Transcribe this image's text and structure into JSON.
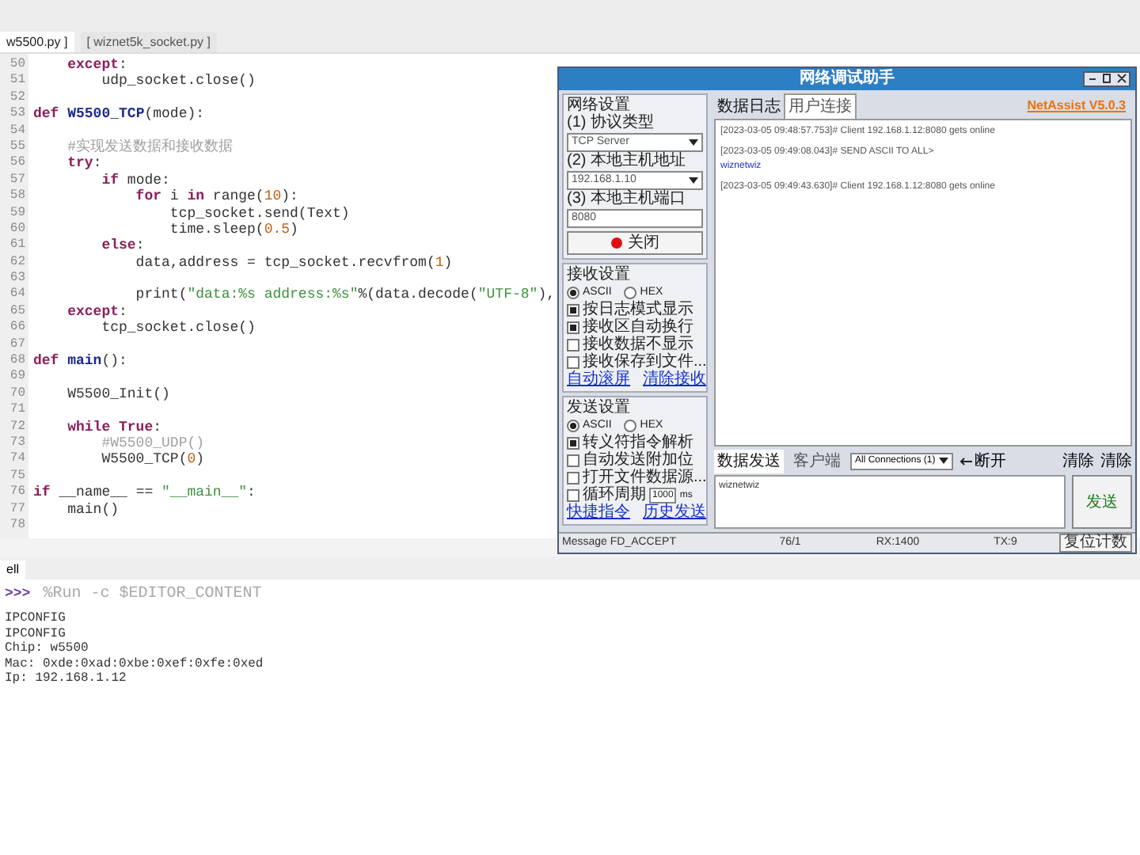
{
  "editor": {
    "tabs": [
      {
        "label": "w5500.py ]",
        "selected": true
      },
      {
        "label": "[ wiznet5k_socket.py ]",
        "selected": false
      }
    ],
    "lines": [
      {
        "number": "50",
        "segments": [
          {
            "kind": "keyword",
            "text": "    except"
          },
          {
            "kind": "plain",
            "text": ":"
          }
        ]
      },
      {
        "number": "51",
        "segments": [
          {
            "kind": "plain",
            "text": "        udp_socket.close()"
          }
        ]
      },
      {
        "number": "52"
      },
      {
        "number": "53",
        "segments": [
          {
            "kind": "keyword",
            "text": "def "
          },
          {
            "kind": "func",
            "text": "W5500_TCP"
          },
          {
            "kind": "plain",
            "text": "(mode):"
          }
        ]
      },
      {
        "number": "54"
      },
      {
        "number": "55",
        "segments": [
          {
            "kind": "comment",
            "text": "    #实现发送数据和接收数据"
          }
        ]
      },
      {
        "number": "56",
        "segments": [
          {
            "kind": "keyword",
            "text": "    try"
          },
          {
            "kind": "plain",
            "text": ":"
          }
        ]
      },
      {
        "number": "57",
        "segments": [
          {
            "kind": "keyword",
            "text": "        if"
          },
          {
            "kind": "plain",
            "text": " mode:"
          }
        ]
      },
      {
        "number": "58",
        "segments": [
          {
            "kind": "keyword",
            "text": "            for"
          },
          {
            "kind": "plain",
            "text": " i "
          },
          {
            "kind": "keyword",
            "text": "in"
          },
          {
            "kind": "plain",
            "text": " range("
          },
          {
            "kind": "number",
            "text": "10"
          },
          {
            "kind": "plain",
            "text": "):"
          }
        ]
      },
      {
        "number": "59",
        "segments": [
          {
            "kind": "plain",
            "text": "                tcp_socket.send(Text)"
          }
        ]
      },
      {
        "number": "60",
        "segments": [
          {
            "kind": "plain",
            "text": "                time.sleep("
          },
          {
            "kind": "number",
            "text": "0.5"
          },
          {
            "kind": "plain",
            "text": ")"
          }
        ]
      },
      {
        "number": "61",
        "segments": [
          {
            "kind": "keyword",
            "text": "        else"
          },
          {
            "kind": "plain",
            "text": ":"
          }
        ]
      },
      {
        "number": "62",
        "segments": [
          {
            "kind": "plain",
            "text": "            data,address = tcp_socket.recvfrom("
          },
          {
            "kind": "number",
            "text": "1"
          },
          {
            "kind": "plain",
            "text": ")"
          }
        ]
      },
      {
        "number": "63"
      },
      {
        "number": "64",
        "segments": [
          {
            "kind": "plain",
            "text": "            print("
          },
          {
            "kind": "string",
            "text": "\"data:%s address:%s\""
          },
          {
            "kind": "plain",
            "text": "%(data.decode("
          },
          {
            "kind": "string",
            "text": "\"UTF-8\""
          },
          {
            "kind": "plain",
            "text": "),"
          }
        ]
      },
      {
        "number": "65",
        "segments": [
          {
            "kind": "keyword",
            "text": "    except"
          },
          {
            "kind": "plain",
            "text": ":"
          }
        ]
      },
      {
        "number": "66",
        "segments": [
          {
            "kind": "plain",
            "text": "        tcp_socket.close()"
          }
        ]
      },
      {
        "number": "67"
      },
      {
        "number": "68",
        "segments": [
          {
            "kind": "keyword",
            "text": "def "
          },
          {
            "kind": "func",
            "text": "main"
          },
          {
            "kind": "plain",
            "text": "():"
          }
        ]
      },
      {
        "number": "69"
      },
      {
        "number": "70",
        "segments": [
          {
            "kind": "plain",
            "text": "    W5500_Init()"
          }
        ]
      },
      {
        "number": "71"
      },
      {
        "number": "72",
        "segments": [
          {
            "kind": "keyword",
            "text": "    while True"
          },
          {
            "kind": "plain",
            "text": ":"
          }
        ]
      },
      {
        "number": "73",
        "segments": [
          {
            "kind": "comment",
            "text": "        #W5500_UDP()"
          }
        ]
      },
      {
        "number": "74",
        "segments": [
          {
            "kind": "plain",
            "text": "        W5500_TCP("
          },
          {
            "kind": "number",
            "text": "0"
          },
          {
            "kind": "plain",
            "text": ")"
          }
        ]
      },
      {
        "number": "75"
      },
      {
        "number": "76",
        "segments": [
          {
            "kind": "keyword",
            "text": "if"
          },
          {
            "kind": "plain",
            "text": " __name__ == "
          },
          {
            "kind": "string",
            "text": "\"__main__\""
          },
          {
            "kind": "plain",
            "text": ":"
          }
        ]
      },
      {
        "number": "77",
        "segments": [
          {
            "kind": "plain",
            "text": "    main()"
          }
        ]
      },
      {
        "number": "78"
      }
    ]
  },
  "shell": {
    "tab": "ell",
    "prompt": ">>>",
    "command": "%Run -c $EDITOR_CONTENT",
    "output": [
      "IPCONFIG",
      "IPCONFIG",
      "Chip: w5500",
      "Mac: 0xde:0xad:0xbe:0xef:0xfe:0xed",
      "Ip: 192.168.1.12"
    ]
  },
  "netassist": {
    "title": "网络调试助手",
    "version": "NetAssist V5.0.3",
    "network": {
      "title": "网络设置",
      "protocol_label": "(1) 协议类型",
      "protocol": "TCP Server",
      "address_label": "(2) 本地主机地址",
      "address": "192.168.1.10",
      "port_label": "(3) 本地主机端口",
      "port": "8080",
      "close_button": "关闭"
    },
    "receive": {
      "title": "接收设置",
      "modes": [
        {
          "label": "ASCII",
          "selected": true
        },
        {
          "label": "HEX",
          "selected": false
        }
      ],
      "options": [
        {
          "label": "按日志模式显示",
          "checked": true
        },
        {
          "label": "接收区自动换行",
          "checked": true
        },
        {
          "label": "接收数据不显示",
          "checked": false
        },
        {
          "label": "接收保存到文件...",
          "checked": false
        }
      ],
      "links": [
        "自动滚屏",
        "清除接收"
      ]
    },
    "send": {
      "title": "发送设置",
      "modes": [
        {
          "label": "ASCII",
          "selected": true
        },
        {
          "label": "HEX",
          "selected": false
        }
      ],
      "options": [
        {
          "label": "转义符指令解析",
          "checked": true
        },
        {
          "label": "自动发送附加位",
          "checked": false
        },
        {
          "label": "打开文件数据源...",
          "checked": false
        },
        {
          "label": "循环周期",
          "checked": false
        }
      ],
      "period": "1000",
      "period_unit": "ms",
      "links": [
        "快捷指令",
        "历史发送"
      ]
    },
    "log_tabs": [
      {
        "label": "数据日志",
        "selected": true
      },
      {
        "label": "用户连接",
        "selected": false
      }
    ],
    "log": [
      {
        "kind": "header",
        "text": "[2023-03-05 09:48:57.753]# Client 192.168.1.12:8080 gets online"
      },
      {
        "kind": "header",
        "text": "[2023-03-05 09:49:08.043]# SEND ASCII TO ALL>"
      },
      {
        "kind": "data",
        "text": "wiznetwiz"
      },
      {
        "kind": "header",
        "text": "[2023-03-05 09:49:43.630]# Client 192.168.1.12:8080 gets online"
      }
    ],
    "send_tabs": [
      {
        "label": "数据发送",
        "selected": true
      },
      {
        "label": "客户端",
        "selected": false
      }
    ],
    "target": "All Connections (1)",
    "disconnect": "断开",
    "clear_buttons": [
      "清除",
      "清除"
    ],
    "send_text": "wiznetwiz",
    "send_button": "发送",
    "status": [
      "Message FD_ACCEPT",
      "76/1",
      "RX:1400",
      "TX:9"
    ],
    "reset_button": "复位计数"
  }
}
